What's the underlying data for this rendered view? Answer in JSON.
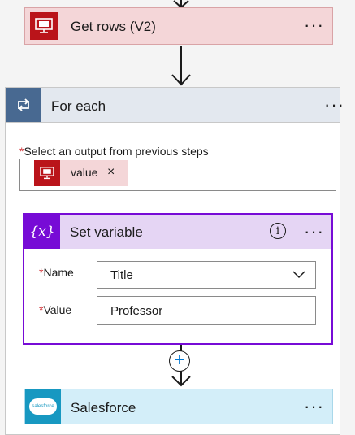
{
  "get_rows": {
    "title": "Get rows (V2)",
    "icon": "sql-icon",
    "color": "#f4d6d8",
    "accent": "#ba141a"
  },
  "for_each": {
    "title": "For each",
    "icon": "loop-icon",
    "header_color": "#e3e8ef",
    "icon_bg": "#486991",
    "output_label": "Select an output from previous steps",
    "required_mark": "*",
    "token": {
      "label": "value",
      "remove": "×",
      "icon": "sql-icon"
    }
  },
  "set_variable": {
    "title": "Set variable",
    "icon": "variable-icon",
    "icon_glyph": "{x}",
    "info_glyph": "i",
    "header_color": "#e5d5f4",
    "accent": "#770bd6",
    "fields": {
      "name_label": "Name",
      "name_value": "Title",
      "value_label": "Value",
      "value_value": "Professor"
    }
  },
  "add_step": {
    "glyph": "+"
  },
  "salesforce": {
    "title": "Salesforce",
    "icon": "salesforce-icon",
    "logo_text": "salesforce",
    "color": "#d3eef9",
    "accent": "#1798c1"
  },
  "menu": {
    "dots": "···"
  }
}
